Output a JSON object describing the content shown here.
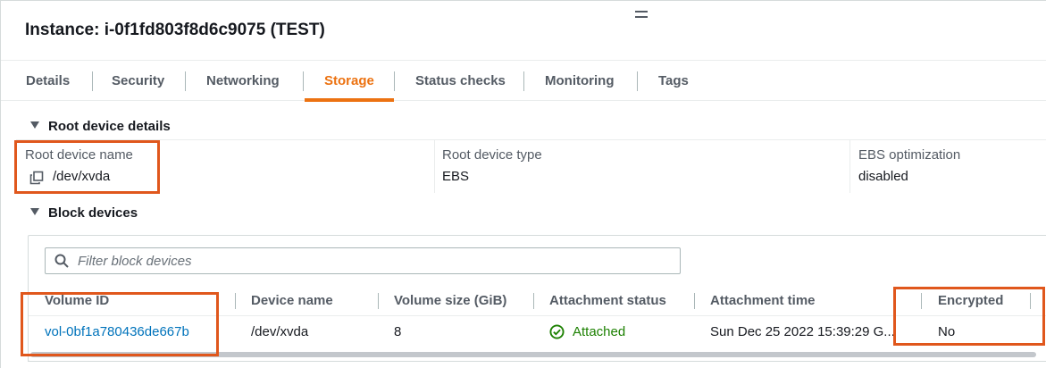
{
  "instance": {
    "title": "Instance: i-0f1fd803f8d6c9075 (TEST)"
  },
  "tabs": [
    {
      "label": "Details"
    },
    {
      "label": "Security"
    },
    {
      "label": "Networking"
    },
    {
      "label": "Storage",
      "active": true
    },
    {
      "label": "Status checks"
    },
    {
      "label": "Monitoring"
    },
    {
      "label": "Tags"
    }
  ],
  "root_device": {
    "section_title": "Root device details",
    "name_label": "Root device name",
    "name_value": "/dev/xvda",
    "type_label": "Root device type",
    "type_value": "EBS",
    "ebs_label": "EBS optimization",
    "ebs_value": "disabled"
  },
  "block_devices": {
    "section_title": "Block devices",
    "filter_placeholder": "Filter block devices",
    "columns": [
      "Volume ID",
      "Device name",
      "Volume size (GiB)",
      "Attachment status",
      "Attachment time",
      "Encrypted"
    ],
    "rows": [
      {
        "volume_id": "vol-0bf1a780436de667b",
        "device_name": "/dev/xvda",
        "volume_size": "8",
        "attachment_status": "Attached",
        "attachment_time": "Sun Dec 25 2022 15:39:29 G...",
        "encrypted": "No"
      }
    ]
  },
  "colors": {
    "active_tab": "#ec7211",
    "link": "#0073bb",
    "success": "#1d8102",
    "highlight_box": "#e0571c"
  },
  "icons": {
    "drag_handle": "drag-handle-icon",
    "caret": "caret-down-icon",
    "copy": "copy-icon",
    "search": "search-icon",
    "status_ok": "check-circle-icon"
  }
}
